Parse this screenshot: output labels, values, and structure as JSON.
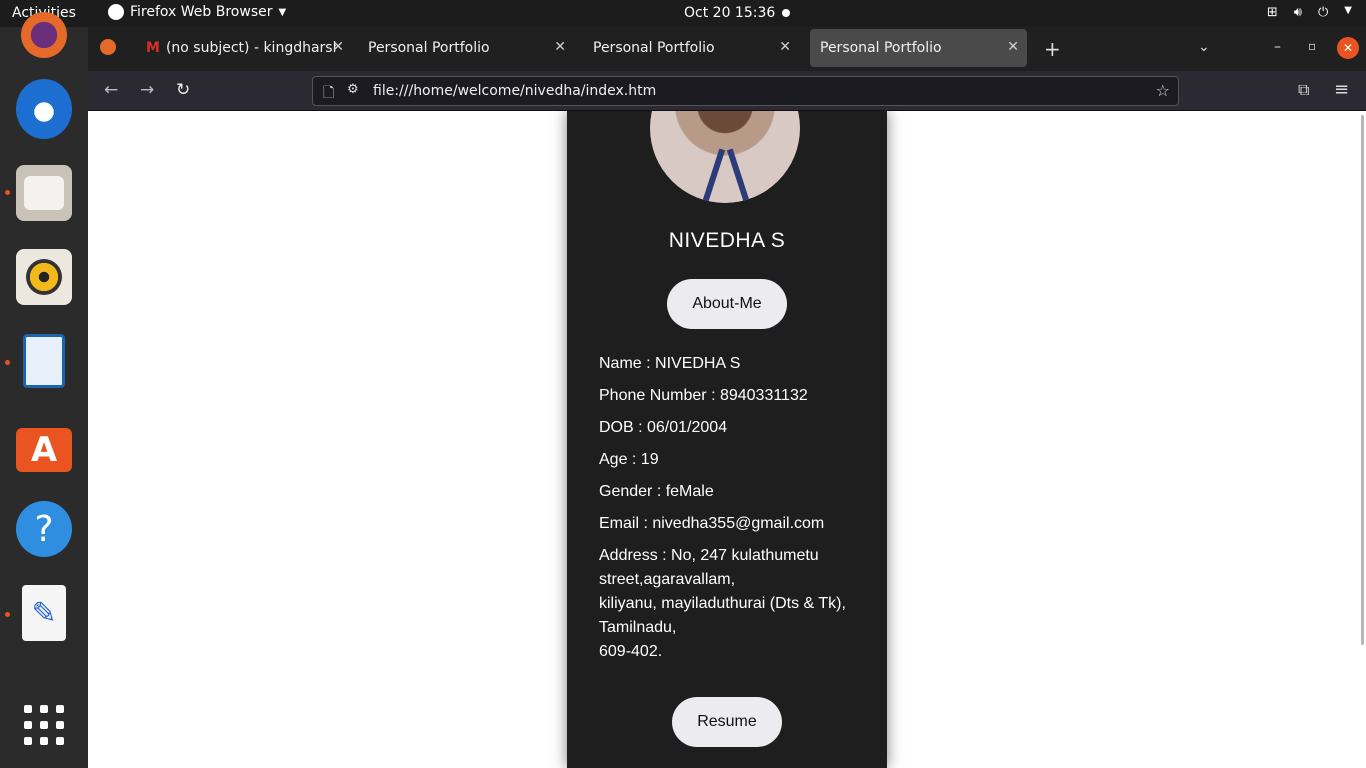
{
  "topbar": {
    "activities": "Activities",
    "app_name": "Firefox Web Browser",
    "datetime": "Oct 20  15:36"
  },
  "browser": {
    "tabs": [
      {
        "label": "(no subject) - kingdharsha",
        "active": false
      },
      {
        "label": "Personal Portfolio",
        "active": false
      },
      {
        "label": "Personal Portfolio",
        "active": false
      },
      {
        "label": "Personal Portfolio",
        "active": true
      }
    ],
    "url": "file:///home/welcome/nivedha/index.htm"
  },
  "profile": {
    "name_heading": "NIVEDHA S",
    "about_button": "About-Me",
    "details": {
      "name": "Name : NIVEDHA S",
      "phone": "Phone Number : 8940331132",
      "dob": "DOB : 06/01/2004",
      "age": "Age : 19",
      "gender": "Gender : feMale",
      "email": "Email : nivedha355@gmail.com",
      "address_line1": "Address : No, 247 kulathumetu street,agaravallam,",
      "address_line2": "kiliyanu, mayiladuthurai (Dts & Tk), Tamilnadu,",
      "address_line3": "609-402."
    },
    "resume_button": "Resume"
  },
  "colors": {
    "accent_dot": "#e95420",
    "card_bg": "#1e1e1e",
    "pill_bg": "#ecebef"
  }
}
